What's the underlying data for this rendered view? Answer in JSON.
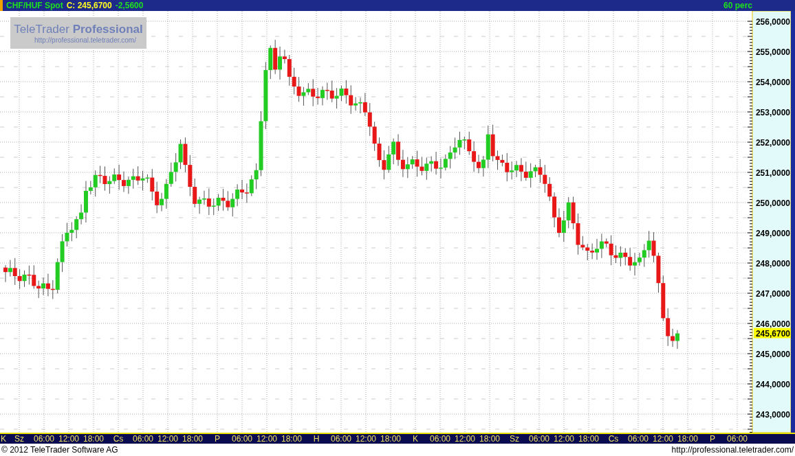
{
  "title_bar": {
    "instrument": "CHF/HUF Spot",
    "close_label": "C: 245,6700",
    "change": "-2,5600",
    "interval": "60 perc"
  },
  "logo": {
    "name": "TeleTrader **Professional**",
    "url": "http://professional.teletrader.com/"
  },
  "y_axis": {
    "labels": [
      "256,0000",
      "255,0000",
      "254,0000",
      "253,0000",
      "252,0000",
      "251,0000",
      "250,0000",
      "249,0000",
      "248,0000",
      "247,0000",
      "246,0000",
      "245,0000",
      "244,0000",
      "243,0000"
    ],
    "current_price": "245,6700"
  },
  "x_axis": {
    "labels": [
      "K",
      "Sz",
      "06:00",
      "12:00",
      "18:00",
      "Cs",
      "06:00",
      "12:00",
      "18:00",
      "P",
      "06:00",
      "12:00",
      "18:00",
      "H",
      "06:00",
      "12:00",
      "18:00",
      "K",
      "06:00",
      "12:00",
      "18:00",
      "Sz",
      "06:00",
      "12:00",
      "18:00",
      "Cs",
      "06:00",
      "12:00",
      "18:00",
      "P",
      "06:00"
    ]
  },
  "footer": {
    "copyright": "© 2012 TeleTrader Software AG",
    "url": "http://professional.teletrader.com/"
  }
}
